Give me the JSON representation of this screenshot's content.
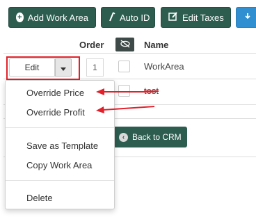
{
  "toolbar": {
    "add_work_area": "Add Work Area",
    "auto_id": "Auto ID",
    "edit_taxes": "Edit Taxes"
  },
  "table": {
    "headers": {
      "order": "Order",
      "name": "Name"
    },
    "rows": [
      {
        "order": "1",
        "name": "WorkArea"
      },
      {
        "order": "",
        "name": "test"
      }
    ]
  },
  "edit_button": {
    "label": "Edit"
  },
  "back_to_crm": "Back to CRM",
  "dropdown": {
    "items": [
      "Override Price",
      "Override Profit",
      "Save as Template",
      "Copy Work Area",
      "Delete"
    ]
  },
  "colors": {
    "primary": "#2c5d4f",
    "accent_blue": "#2f8fd0",
    "annotation_red": "#e3202a"
  }
}
